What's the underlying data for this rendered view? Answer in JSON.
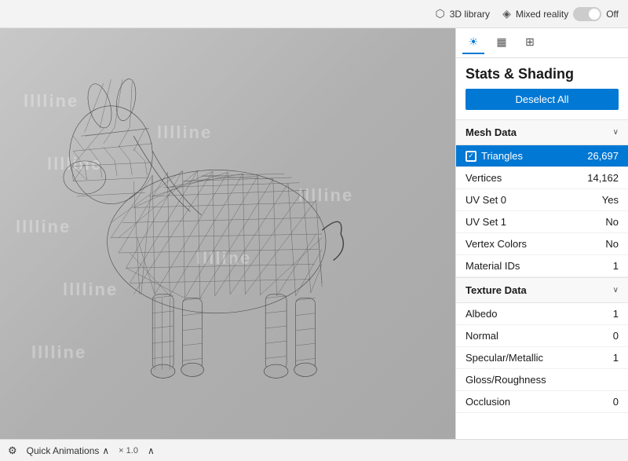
{
  "topbar": {
    "library_label": "3D library",
    "mixed_reality_label": "Mixed reality",
    "toggle_state": "Off"
  },
  "panel": {
    "title": "Stats & Shading",
    "deselect_label": "Deselect All",
    "tabs": [
      {
        "id": "sun",
        "icon": "☀",
        "active": true
      },
      {
        "id": "chart",
        "icon": "▦",
        "active": false
      },
      {
        "id": "grid",
        "icon": "⊞",
        "active": false
      }
    ],
    "mesh_section": {
      "label": "Mesh Data",
      "rows": [
        {
          "label": "Triangles",
          "value": "26,697",
          "highlighted": true,
          "has_checkbox": true
        },
        {
          "label": "Vertices",
          "value": "14,162",
          "highlighted": false,
          "has_checkbox": false
        },
        {
          "label": "UV Set 0",
          "value": "Yes",
          "highlighted": false,
          "has_checkbox": false
        },
        {
          "label": "UV Set 1",
          "value": "No",
          "highlighted": false,
          "has_checkbox": false
        },
        {
          "label": "Vertex Colors",
          "value": "No",
          "highlighted": false,
          "has_checkbox": false
        },
        {
          "label": "Material IDs",
          "value": "1",
          "highlighted": false,
          "has_checkbox": false
        }
      ]
    },
    "texture_section": {
      "label": "Texture Data",
      "rows": [
        {
          "label": "Albedo",
          "value": "1",
          "highlighted": false,
          "has_checkbox": false
        },
        {
          "label": "Normal",
          "value": "0",
          "highlighted": false,
          "has_checkbox": false
        },
        {
          "label": "Specular/Metallic",
          "value": "1",
          "highlighted": false,
          "has_checkbox": false
        },
        {
          "label": "Gloss/Roughness",
          "value": "",
          "highlighted": false,
          "has_checkbox": false
        },
        {
          "label": "Occlusion",
          "value": "0",
          "highlighted": false,
          "has_checkbox": false
        }
      ]
    }
  },
  "statusbar": {
    "quick_animations_label": "Quick Animations",
    "multiplier": "× 1.0"
  },
  "watermarks": [
    "lllline",
    "lllline",
    "lllline",
    "lllline",
    "lllline",
    "lllline",
    "lllline",
    "lllline"
  ]
}
